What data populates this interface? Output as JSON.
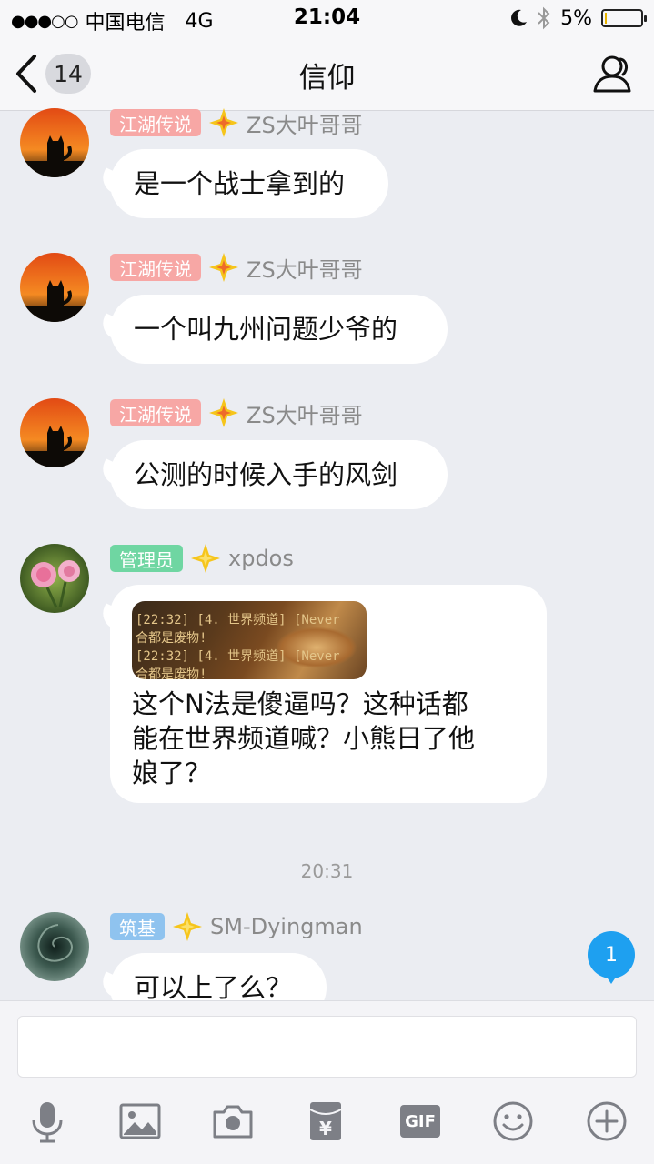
{
  "status_bar": {
    "signal": "●●●○○",
    "carrier": "中国电信",
    "network": "4G",
    "time": "21:04",
    "battery": "5%",
    "battery_level": 0.05
  },
  "nav": {
    "back_count": "14",
    "title": "信仰"
  },
  "messages": [
    {
      "tag": "江湖传说",
      "tag_color": "#f7a7a5",
      "user": "ZS大叶哥哥",
      "text": "是一个战士拿到的"
    },
    {
      "tag": "江湖传说",
      "tag_color": "#f7a7a5",
      "user": "ZS大叶哥哥",
      "text": "一个叫九州问题少爷的"
    },
    {
      "tag": "江湖传说",
      "tag_color": "#f7a7a5",
      "user": "ZS大叶哥哥",
      "text": "公测的时候入手的风剑"
    },
    {
      "tag": "管理员",
      "tag_color": "#6fd6a2",
      "user": "xpdos",
      "image_lines": [
        "[22:32] [4. 世界频道] [Never",
        "合都是废物!",
        "[22:32] [4. 世界频道] [Never",
        "合都是废物!"
      ],
      "text_lines": [
        "这个N法是傻逼吗？这种话都",
        "能在世界频道喊？小熊日了他",
        "娘了？"
      ]
    },
    {
      "tag": "筑基",
      "tag_color": "#8fc3ef",
      "user": "SM-Dyingman",
      "text": "可以上了么？"
    }
  ],
  "timestamp": "20:31",
  "unread_count": "1",
  "toolbar": {
    "icons": [
      "microphone-icon",
      "image-icon",
      "camera-icon",
      "red-packet-icon",
      "gif-icon",
      "emoji-icon",
      "plus-icon"
    ],
    "gif_label": "GIF",
    "red_packet_symbol": "¥"
  }
}
